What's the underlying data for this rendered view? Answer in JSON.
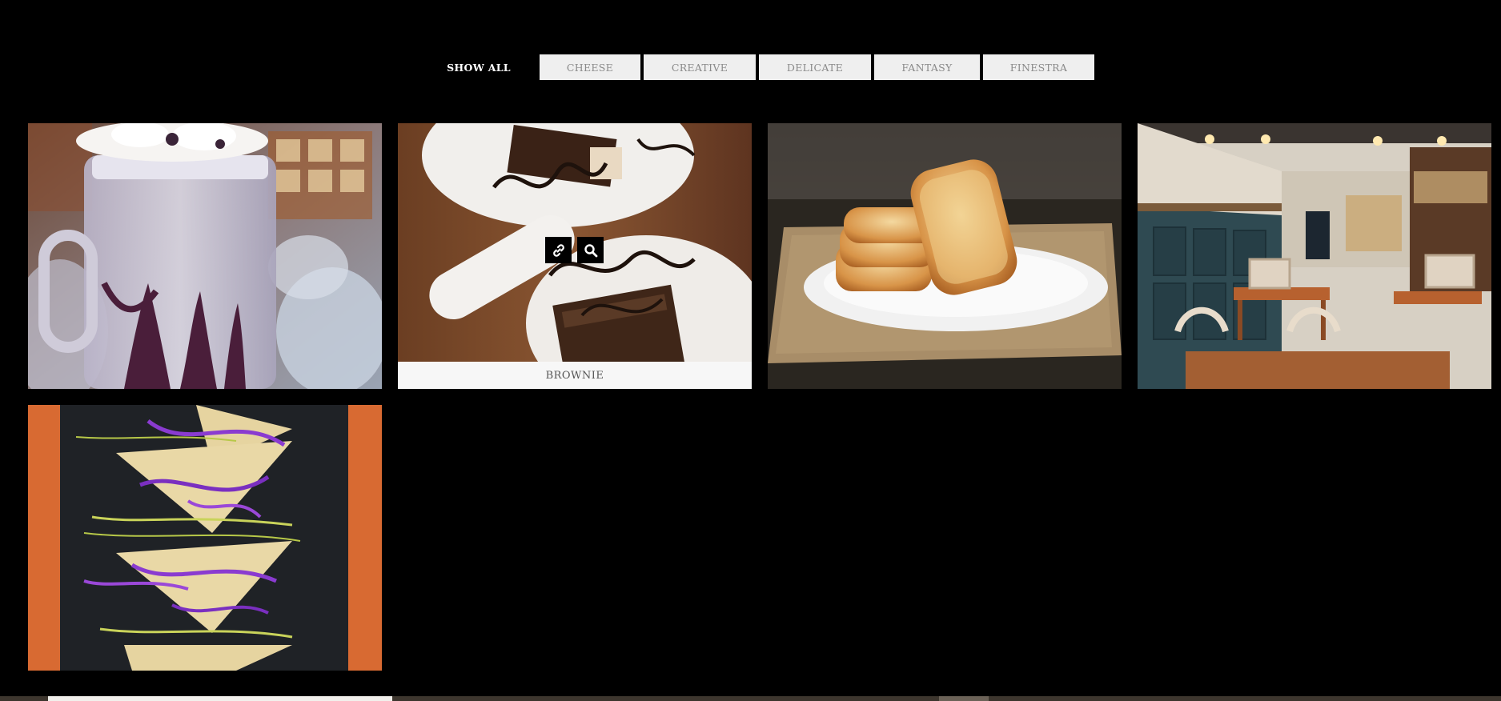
{
  "filters": {
    "items": [
      {
        "label": "SHOW ALL",
        "active": true
      },
      {
        "label": "CHEESE",
        "active": false
      },
      {
        "label": "CREATIVE",
        "active": false
      },
      {
        "label": "DELICATE",
        "active": false
      },
      {
        "label": "FANTASY",
        "active": false
      },
      {
        "label": "FINESTRA",
        "active": false
      }
    ]
  },
  "gallery": {
    "items": [
      {
        "subject": "milkshake jar with whipped cream and chocolate drizzle"
      },
      {
        "subject": "brownies with chocolate drizzle on white plates",
        "caption": "BROWNIE",
        "hovered": true,
        "actions": [
          "link-icon",
          "search-icon"
        ]
      },
      {
        "subject": "toasted bread slices on white plate"
      },
      {
        "subject": "cafe interior with wooden tables and chairs"
      },
      {
        "subject": "triangle sandwiches with purple cabbage"
      }
    ]
  },
  "colors": {
    "background": "#000000",
    "filter_inactive_bg": "#efefef",
    "filter_inactive_text": "#8a8a8a",
    "caption_bg": "#f7f7f7"
  }
}
